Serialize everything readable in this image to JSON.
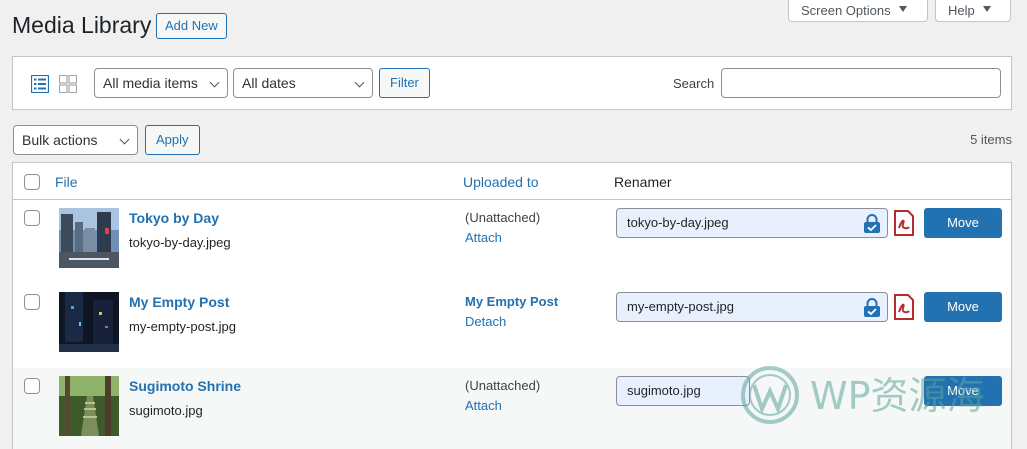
{
  "page": {
    "title": "Media Library",
    "add_new_label": "Add New",
    "screen_options_label": "Screen Options",
    "help_label": "Help"
  },
  "filters": {
    "media_type_selected": "All media items",
    "date_selected": "All dates",
    "filter_button": "Filter",
    "search_label": "Search",
    "search_value": ""
  },
  "bulk": {
    "selected": "Bulk actions",
    "apply_label": "Apply",
    "items_count": "5 items"
  },
  "table": {
    "columns": [
      "File",
      "Uploaded to",
      "Renamer"
    ],
    "rows": [
      {
        "title": "Tokyo by Day",
        "filename": "tokyo-by-day.jpeg",
        "uploaded_to": "(Unattached)",
        "uploaded_action": "Attach",
        "rename_value": "tokyo-by-day.jpeg",
        "move_label": "Move"
      },
      {
        "title": "My Empty Post",
        "filename": "my-empty-post.jpg",
        "uploaded_to": "My Empty Post",
        "uploaded_action": "Detach",
        "rename_value": "my-empty-post.jpg",
        "move_label": "Move"
      },
      {
        "title": "Sugimoto Shrine",
        "filename": "sugimoto.jpg",
        "uploaded_to": "(Unattached)",
        "uploaded_action": "Attach",
        "rename_value": "sugimoto.jpg",
        "move_label": "Move"
      }
    ]
  },
  "watermark": {
    "text": "WP资源海"
  },
  "colors": {
    "accent": "#2271b1",
    "pdf_red": "#b32d2e",
    "lock_blue": "#2271b1"
  },
  "icons": [
    "list-view-icon",
    "grid-view-icon",
    "chevron-down-icon",
    "lock-icon",
    "pdf-icon",
    "caret-down-icon"
  ]
}
